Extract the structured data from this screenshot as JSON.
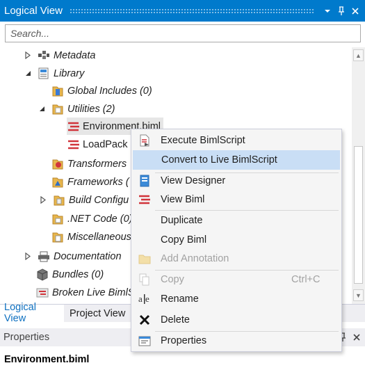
{
  "window": {
    "title": "Logical View"
  },
  "search": {
    "placeholder": "Search..."
  },
  "tree": {
    "metadata": "Metadata",
    "library": "Library",
    "global_includes": "Global Includes (0)",
    "utilities": "Utilities (2)",
    "environment_biml": "Environment.biml",
    "loadpack": "LoadPack",
    "transformers": "Transformers",
    "frameworks": "Frameworks (",
    "build_config": "Build Configu",
    "net_code": ".NET Code (0)",
    "miscellaneous": "Miscellaneous",
    "documentation": "Documentation",
    "bundles": "Bundles (0)",
    "broken_live": "Broken Live BimlS"
  },
  "tabs": {
    "logical": "Logical View",
    "project": "Project View"
  },
  "properties": {
    "title": "Properties",
    "object": "Environment.biml"
  },
  "context_menu": {
    "execute": "Execute BimlScript",
    "convert": "Convert to Live BimlScript",
    "view_designer": "View Designer",
    "view_biml": "View Biml",
    "duplicate": "Duplicate",
    "copy_biml": "Copy Biml",
    "add_annotation": "Add Annotation",
    "copy": "Copy",
    "copy_shortcut": "Ctrl+C",
    "rename": "Rename",
    "delete": "Delete",
    "properties": "Properties"
  },
  "colors": {
    "accent": "#007acc",
    "highlight": "#c9def5",
    "folder": "#e8b64c",
    "biml_red": "#d1343b"
  }
}
